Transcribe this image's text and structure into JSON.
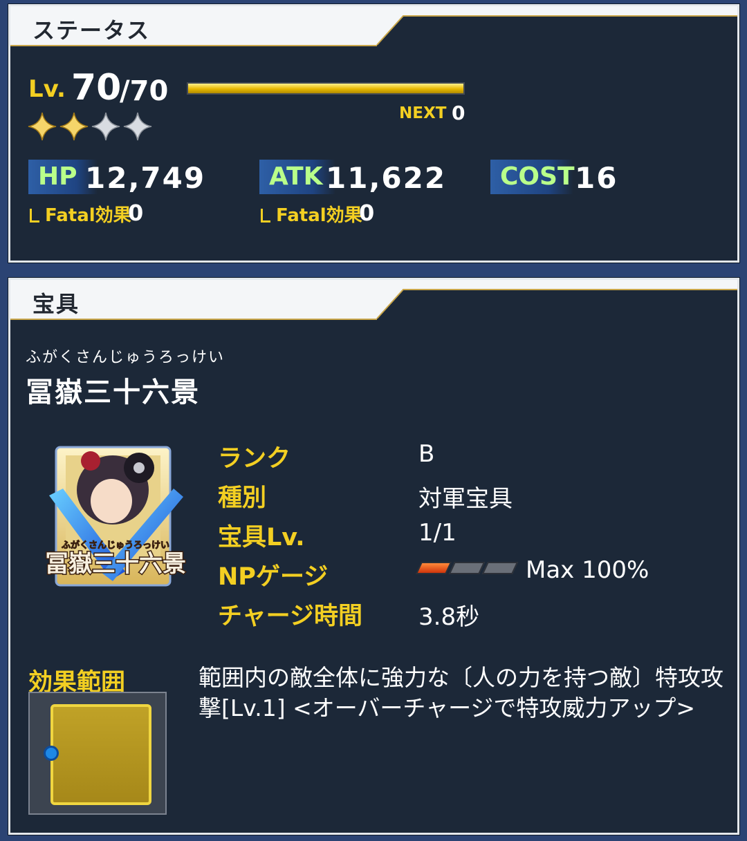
{
  "status": {
    "header": "ステータス",
    "level_label": "Lv.",
    "level_current": "70",
    "level_max": "/70",
    "exp_progress": 1.0,
    "next_label": "NEXT",
    "next_value": "0",
    "rarity_stars_filled": 2,
    "rarity_stars_total": 4,
    "hp_label": "HP",
    "hp_value": "12,749",
    "atk_label": "ATK",
    "atk_value": "11,622",
    "cost_label": "COST",
    "cost_value": "16",
    "hp_fatal_label": "Fatal効果",
    "hp_fatal_value": "0",
    "atk_fatal_label": "Fatal効果",
    "atk_fatal_value": "0"
  },
  "noble_phantasm": {
    "header": "宝具",
    "ruby": "ふがくさんじゅうろっけい",
    "name": "冨嶽三十六景",
    "card_ruby": "ふがくさんじゅうろっけい",
    "card_title": "冨嶽三十六景",
    "rank_label": "ランク",
    "rank_value": "B",
    "type_label": "種別",
    "type_value": "対軍宝具",
    "level_label": "宝具Lv.",
    "level_value": "1/1",
    "gauge_label": "NPゲージ",
    "gauge_filled": 1,
    "gauge_total": 3,
    "gauge_max": "Max 100%",
    "charge_label": "チャージ時間",
    "charge_value": "3.8秒",
    "range_label": "効果範囲",
    "effect_text": "範囲内の敵全体に強力な〔人の力を持つ敵〕特攻攻撃[Lv.1] <オーバーチャージで特攻威力アップ>"
  },
  "colors": {
    "accent_yellow": "#f3cf22",
    "stat_green": "#b9ff8a",
    "panel_bg": "#1c2838",
    "page_bg": "#2b4373"
  }
}
